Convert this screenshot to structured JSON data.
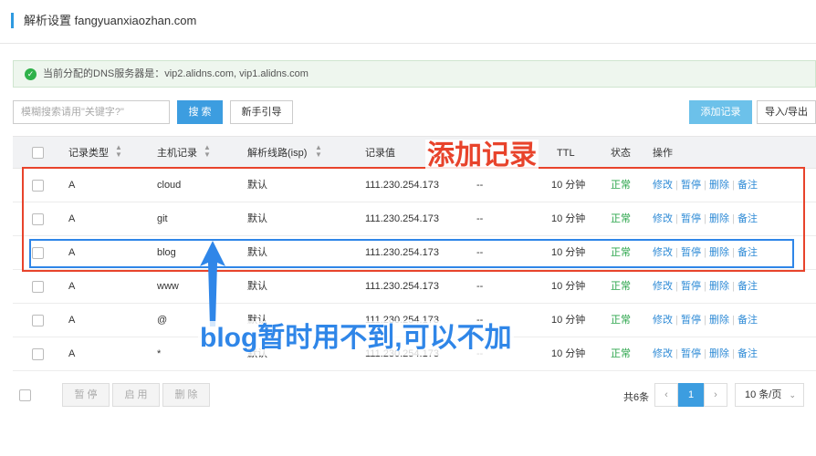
{
  "header": {
    "title": "解析设置 fangyuanxiaozhan.com"
  },
  "notice": {
    "icon": "check-circle-icon",
    "text": "当前分配的DNS服务器是：vip2.alidns.com, vip1.alidns.com"
  },
  "toolbar": {
    "search_placeholder": "模糊搜索请用\"关键字?\"",
    "search_label": "搜 索",
    "guide_label": "新手引导",
    "add_label": "添加记录",
    "import_label": "导入/导出"
  },
  "table": {
    "headers": {
      "type": "记录类型",
      "host": "主机记录",
      "line": "解析线路(isp)",
      "value": "记录值",
      "ttl": "TTL",
      "status": "状态",
      "actions": "操作"
    },
    "rows": [
      {
        "type": "A",
        "host": "cloud",
        "line": "默认",
        "value": "111.230.254.173",
        "mx": "--",
        "ttl": "10 分钟",
        "status": "正常"
      },
      {
        "type": "A",
        "host": "git",
        "line": "默认",
        "value": "111.230.254.173",
        "mx": "--",
        "ttl": "10 分钟",
        "status": "正常"
      },
      {
        "type": "A",
        "host": "blog",
        "line": "默认",
        "value": "111.230.254.173",
        "mx": "--",
        "ttl": "10 分钟",
        "status": "正常"
      },
      {
        "type": "A",
        "host": "www",
        "line": "默认",
        "value": "111.230.254.173",
        "mx": "--",
        "ttl": "10 分钟",
        "status": "正常"
      },
      {
        "type": "A",
        "host": "@",
        "line": "默认",
        "value": "111.230.254.173",
        "mx": "--",
        "ttl": "10 分钟",
        "status": "正常"
      },
      {
        "type": "A",
        "host": "*",
        "line": "默认",
        "value": "111.230.254.173",
        "mx": "--",
        "ttl": "10 分钟",
        "status": "正常"
      }
    ],
    "row_actions": {
      "edit": "修改",
      "pause": "暂停",
      "delete": "删除",
      "note": "备注"
    }
  },
  "footer": {
    "pause": "暂 停",
    "enable": "启 用",
    "delete": "删 除",
    "total": "共6条",
    "prev": "‹",
    "page": "1",
    "next": "›",
    "page_size": "10 条/页"
  },
  "annotations": {
    "red_label": "添加记录",
    "blue_label": "blog暂时用不到,可以不加",
    "red_color": "#e8432b",
    "blue_color": "#2f86e8"
  }
}
